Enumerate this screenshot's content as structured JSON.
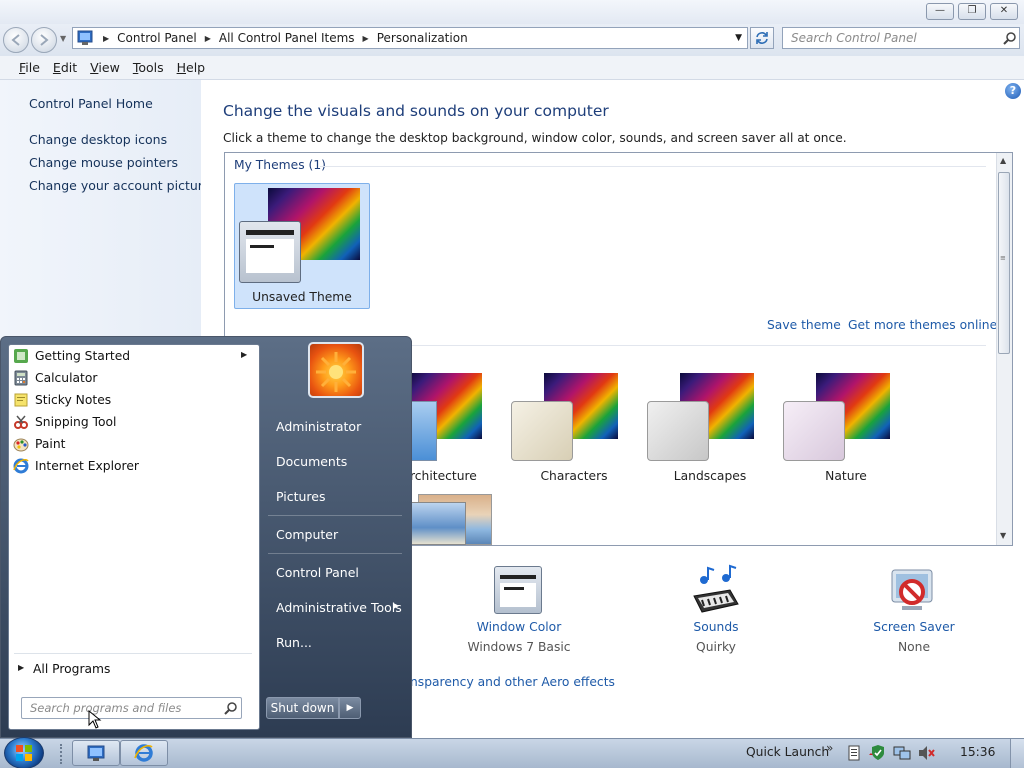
{
  "window": {
    "caption_buttons": {
      "minimize": "—",
      "maximize": "❐",
      "close": "✕"
    }
  },
  "address_bar": {
    "breadcrumb": [
      "Control Panel",
      "All Control Panel Items",
      "Personalization"
    ],
    "search_placeholder": "Search Control Panel"
  },
  "menu_bar": [
    "File",
    "Edit",
    "View",
    "Tools",
    "Help"
  ],
  "left_nav": {
    "home": "Control Panel Home",
    "links": [
      "Change desktop icons",
      "Change mouse pointers",
      "Change your account picture"
    ]
  },
  "main": {
    "heading": "Change the visuals and sounds on your computer",
    "description": "Click a theme to change the desktop background, window color, sounds, and screen saver all at once.",
    "help_glyph": "?",
    "my_themes": {
      "label": "My Themes (1)",
      "selected_theme": "Unsaved Theme"
    },
    "actions": {
      "save": "Save theme",
      "more": "Get more themes online"
    },
    "aero_themes": [
      "rchitecture",
      "Characters",
      "Landscapes",
      "Nature"
    ],
    "bottom": {
      "window_color": {
        "label": "Window Color",
        "value": "Windows 7 Basic"
      },
      "sounds": {
        "label": "Sounds",
        "value": "Quirky"
      },
      "screen_saver": {
        "label": "Screen Saver",
        "value": "None"
      },
      "partial_link": "nsparency and other Aero effects"
    }
  },
  "start_menu": {
    "programs": [
      {
        "label": "Getting Started",
        "has_submenu": true,
        "icon": "getting-started-icon"
      },
      {
        "label": "Calculator",
        "icon": "calculator-icon"
      },
      {
        "label": "Sticky Notes",
        "icon": "sticky-notes-icon"
      },
      {
        "label": "Snipping Tool",
        "icon": "snipping-tool-icon"
      },
      {
        "label": "Paint",
        "icon": "paint-icon"
      },
      {
        "label": "Internet Explorer",
        "icon": "internet-explorer-icon"
      }
    ],
    "all_programs": "All Programs",
    "search_placeholder": "Search programs and files",
    "right_items": [
      "Administrator",
      "Documents",
      "Pictures",
      "Computer",
      "Control Panel",
      "Administrative Tools",
      "Run..."
    ],
    "shutdown": "Shut down"
  },
  "taskbar": {
    "quick_launch": "Quick Launch",
    "clock": "15:36"
  },
  "colors": {
    "heading_blue": "#1e3e7a",
    "link_blue": "#1e5aa8",
    "start_menu_dark": "#2d3c52"
  }
}
